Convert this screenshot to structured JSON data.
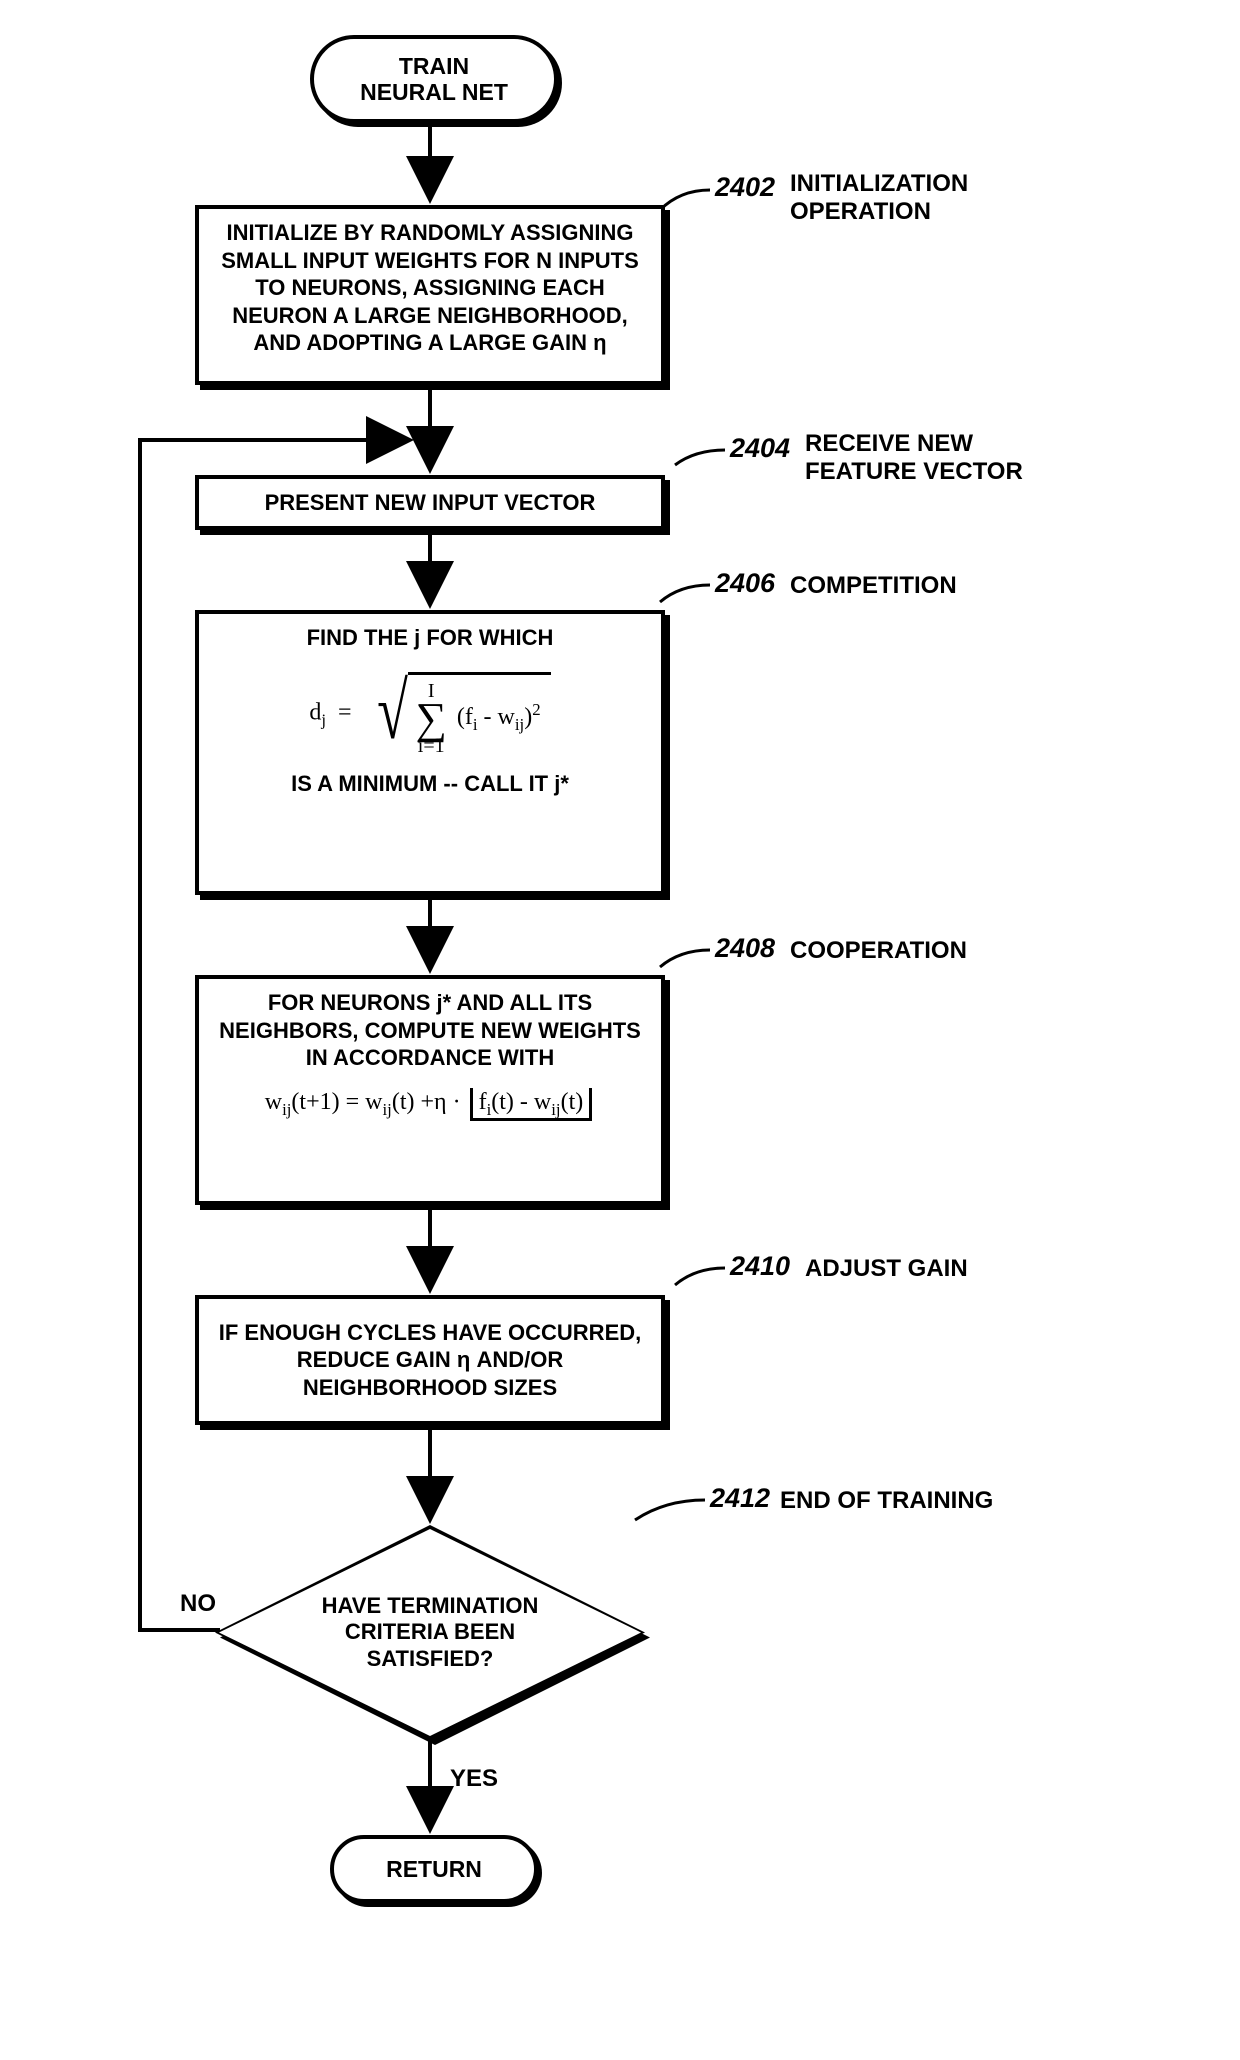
{
  "terminal_start": {
    "line1": "TRAIN",
    "line2": "NEURAL NET"
  },
  "terminal_end": "RETURN",
  "steps": {
    "s2402": {
      "text": "INITIALIZE BY RANDOMLY ASSIGNING SMALL INPUT WEIGHTS FOR N INPUTS TO NEURONS, ASSIGNING EACH NEURON A LARGE NEIGHBORHOOD, AND ADOPTING A LARGE GAIN η",
      "ref": "2402",
      "label": "INITIALIZATION OPERATION"
    },
    "s2404": {
      "text": "PRESENT NEW INPUT VECTOR",
      "ref": "2404",
      "label": "RECEIVE NEW FEATURE VECTOR"
    },
    "s2406": {
      "top": "FIND THE j FOR WHICH",
      "bottom": "IS A MINIMUM -- CALL IT j*",
      "ref": "2406",
      "label": "COMPETITION",
      "formula": {
        "lhs_var": "d",
        "lhs_sub": "j",
        "sum_upper": "I",
        "sum_lower": "i=1",
        "term_a": "f",
        "term_a_sub": "i",
        "term_b": "w",
        "term_b_sub": "ij",
        "power": "2"
      }
    },
    "s2408": {
      "top": "FOR NEURONS j* AND ALL ITS NEIGHBORS, COMPUTE NEW WEIGHTS IN ACCORDANCE WITH",
      "ref": "2408",
      "label": "COOPERATION",
      "formula": {
        "lhs": "w",
        "lhs_sub": "ij",
        "lhs_arg": "(t+1)",
        "rhs1": "w",
        "rhs1_sub": "ij",
        "rhs1_arg": "(t)",
        "plus": "+",
        "eta": "η",
        "dot": "·",
        "f": "f",
        "f_sub": "i",
        "f_arg": "(t)",
        "minus": "-",
        "w2": "w",
        "w2_sub": "ij",
        "w2_arg": "(t)"
      }
    },
    "s2410": {
      "text": "IF ENOUGH CYCLES HAVE OCCURRED, REDUCE GAIN η AND/OR NEIGHBORHOOD SIZES",
      "ref": "2410",
      "label": "ADJUST GAIN"
    },
    "s2412": {
      "text": "HAVE TERMINATION CRITERIA BEEN SATISFIED?",
      "ref": "2412",
      "label": "END OF TRAINING"
    }
  },
  "edges": {
    "no": "NO",
    "yes": "YES"
  }
}
